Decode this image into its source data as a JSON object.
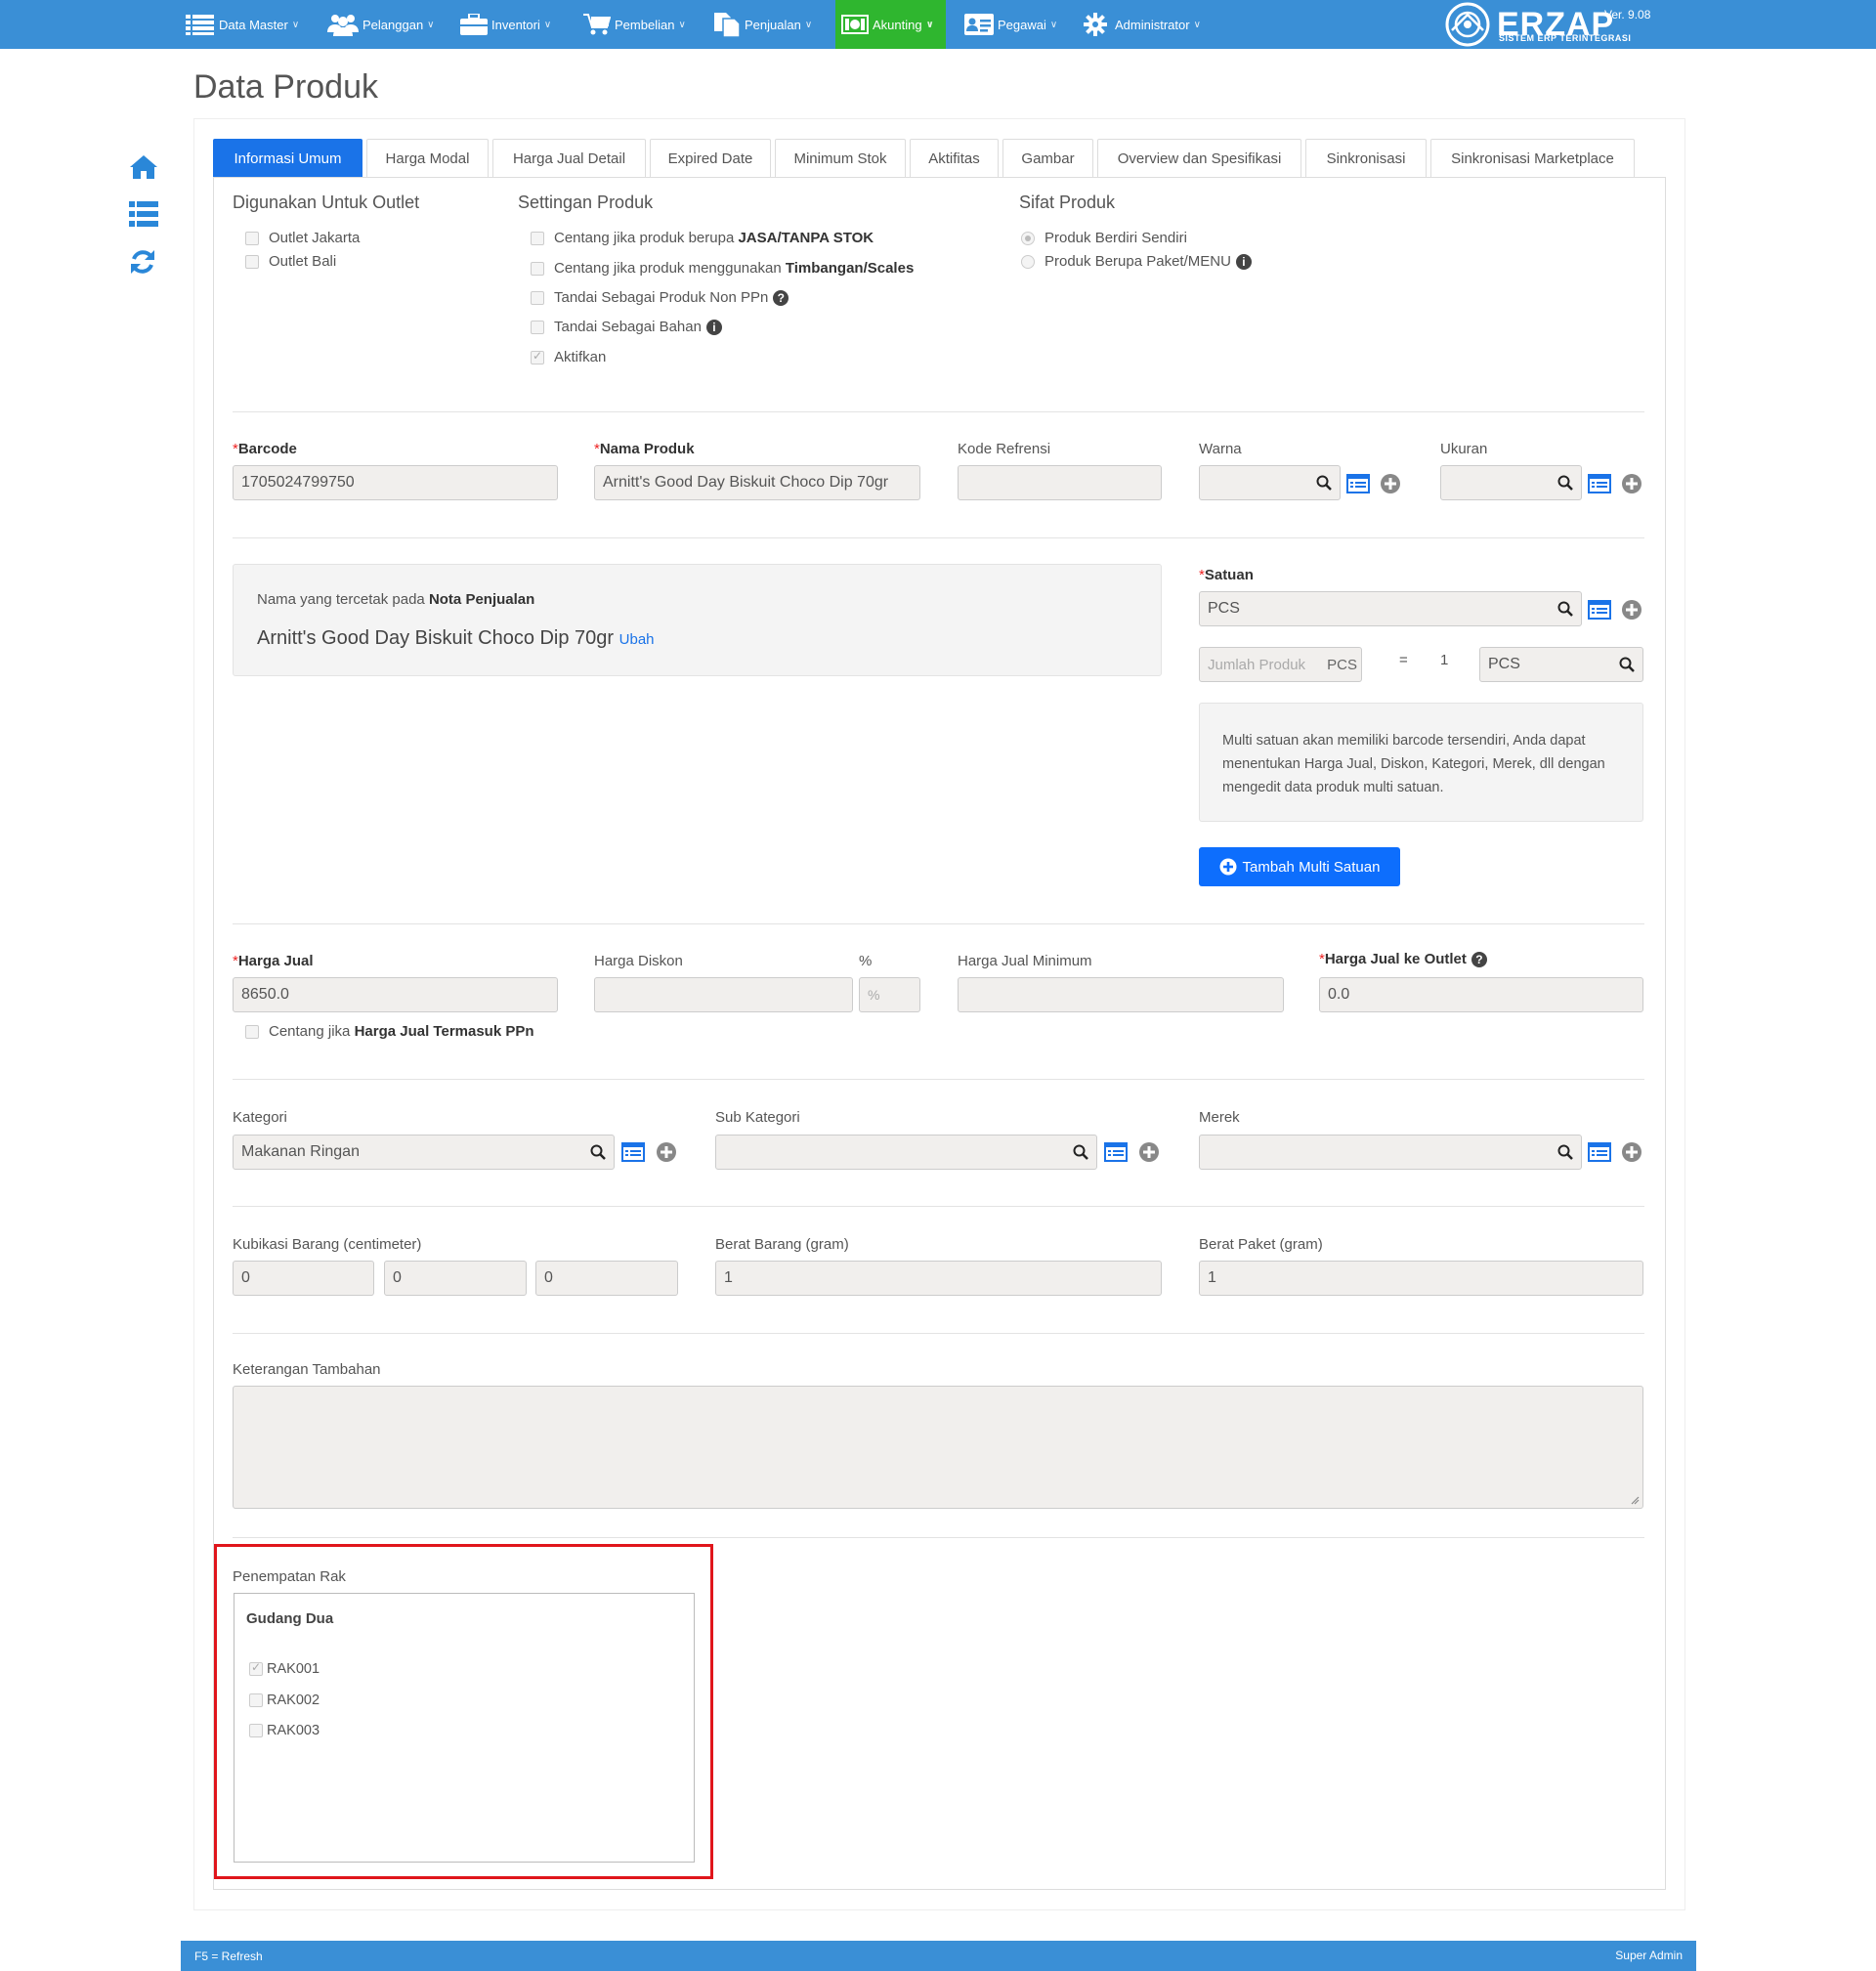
{
  "nav": {
    "items": [
      {
        "label": "Data Master",
        "icon": "list-icon"
      },
      {
        "label": "Pelanggan",
        "icon": "users-icon"
      },
      {
        "label": "Inventori",
        "icon": "briefcase-icon"
      },
      {
        "label": "Pembelian",
        "icon": "cart-icon"
      },
      {
        "label": "Penjualan",
        "icon": "documents-icon"
      },
      {
        "label": "Akunting",
        "icon": "money-icon"
      },
      {
        "label": "Pegawai",
        "icon": "id-card-icon"
      },
      {
        "label": "Administrator",
        "icon": "gear-icon"
      }
    ],
    "logo": {
      "name": "ERZAP",
      "subtitle": "SISTEM ERP TERINTEGRASI",
      "version": "Ver. 9.08"
    }
  },
  "page": {
    "title": "Data Produk"
  },
  "tabs": [
    "Informasi Umum",
    "Harga Modal",
    "Harga Jual Detail",
    "Expired Date",
    "Minimum Stok",
    "Aktifitas",
    "Gambar",
    "Overview dan Spesifikasi",
    "Sinkronisasi",
    "Sinkronisasi Marketplace"
  ],
  "outlet": {
    "title": "Digunakan Untuk Outlet",
    "options": [
      {
        "label": "Outlet Jakarta",
        "checked": false
      },
      {
        "label": "Outlet Bali",
        "checked": false
      }
    ]
  },
  "settings": {
    "title": "Settingan Produk",
    "jasa_prefix": "Centang jika produk berupa ",
    "jasa_bold": "JASA/TANPA STOK",
    "timbangan_prefix": "Centang jika produk menggunakan ",
    "timbangan_bold": "Timbangan/Scales",
    "non_ppn": "Tandai Sebagai Produk Non PPn",
    "bahan": "Tandai Sebagai Bahan",
    "aktifkan": "Aktifkan"
  },
  "sifat": {
    "title": "Sifat Produk",
    "options": [
      "Produk Berdiri Sendiri",
      "Produk Berupa Paket/MENU"
    ]
  },
  "fields": {
    "barcode_label": "Barcode",
    "barcode_value": "1705024799750",
    "nama_label": "Nama Produk",
    "nama_value": "Arnitt's Good Day Biskuit Choco Dip 70gr",
    "kode_label": "Kode Refrensi",
    "kode_value": "",
    "warna_label": "Warna",
    "ukuran_label": "Ukuran"
  },
  "nota": {
    "prefix": "Nama yang tercetak pada ",
    "bold": "Nota Penjualan",
    "name": "Arnitt's Good Day Biskuit Choco Dip 70gr",
    "edit_link": "Ubah"
  },
  "satuan": {
    "label": "Satuan",
    "value": "PCS",
    "jumlah_placeholder": "Jumlah Produk",
    "jumlah_unit": "PCS",
    "equals": "=",
    "qty": "1",
    "target_unit": "PCS",
    "info": "Multi satuan akan memiliki barcode tersendiri, Anda dapat menentukan Harga Jual, Diskon, Kategori, Merek, dll dengan mengedit data produk multi satuan.",
    "add_button": "Tambah Multi Satuan"
  },
  "harga": {
    "jual_label": "Harga Jual",
    "jual_value": "8650.0",
    "diskon_label": "Harga Diskon",
    "percent_label": "%",
    "percent_placeholder": "%",
    "minimum_label": "Harga Jual Minimum",
    "outlet_label": "Harga Jual ke Outlet",
    "outlet_value": "0.0",
    "ppn_prefix": "Centang jika ",
    "ppn_bold": "Harga Jual Termasuk PPn"
  },
  "kategori": {
    "kategori_label": "Kategori",
    "kategori_value": "Makanan Ringan",
    "sub_label": "Sub Kategori",
    "sub_value": "",
    "merek_label": "Merek",
    "merek_value": ""
  },
  "dimensi": {
    "kubikasi_label": "Kubikasi Barang (centimeter)",
    "kubikasi_values": [
      "0",
      "0",
      "0"
    ],
    "berat_label": "Berat Barang (gram)",
    "berat_value": "1",
    "paket_label": "Berat Paket (gram)",
    "paket_value": "1"
  },
  "keterangan": {
    "label": "Keterangan Tambahan",
    "value": ""
  },
  "rak": {
    "label": "Penempatan Rak",
    "gudang": "Gudang Dua",
    "items": [
      {
        "label": "RAK001",
        "checked": true
      },
      {
        "label": "RAK002",
        "checked": false
      },
      {
        "label": "RAK003",
        "checked": false
      }
    ]
  },
  "footer": {
    "left": "F5 = Refresh",
    "right": "Super Admin"
  },
  "colors": {
    "nav": "#3a8fd6",
    "active_nav": "#2fb62f",
    "primary": "#0d6efd",
    "highlight": "#e0151b"
  }
}
